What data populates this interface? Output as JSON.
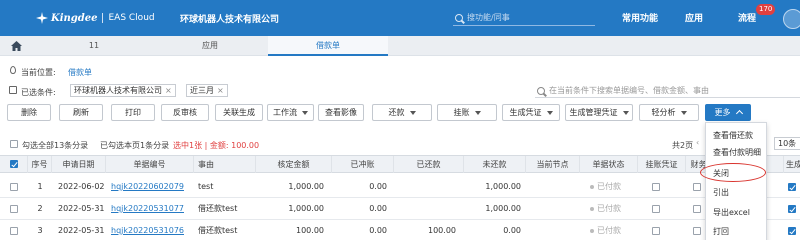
{
  "header": {
    "brand": "Kingdee",
    "product": "EAS Cloud",
    "company": "环球机器人技术有限公司",
    "search_placeholder": "搜功能/同事",
    "nav": [
      "常用功能",
      "应用",
      "流程"
    ],
    "badge": "170"
  },
  "tabs": {
    "items": [
      "11",
      "应用",
      "借款单"
    ],
    "active": "借款单"
  },
  "location": {
    "label": "当前位置:",
    "value": "借款单"
  },
  "filters": {
    "label": "已选条件:",
    "chips": [
      "环球机器人技术有限公司",
      "近三月"
    ],
    "search_placeholder": "在当前条件下搜索单据编号、借款金额、事由"
  },
  "toolbar": {
    "buttons": [
      "删除",
      "刷新",
      "打印",
      "反审核",
      "关联生成",
      "工作流",
      "查看影像",
      "还款",
      "挂账",
      "生成凭证",
      "生成管理凭证",
      "轻分析",
      "更多"
    ]
  },
  "info": {
    "select_all": "勾选全部13条分录",
    "select_page": "已勾选本页1条分录",
    "selected_summary": "选中1张 | 金额: 100.00",
    "total": "共2页",
    "page_current": "1",
    "page_total": "/2",
    "page_size": "10条"
  },
  "table": {
    "columns": [
      "序号",
      "申请日期",
      "单据编号",
      "事由",
      "核定金额",
      "已冲账",
      "已还款",
      "未还款",
      "当前节点",
      "单据状态",
      "挂账凭证",
      "财务",
      "",
      "生成"
    ],
    "rows": [
      {
        "seq": "1",
        "date": "2022-06-02",
        "number": "hqjk20220602079",
        "reason": "test",
        "approved": "1,000.00",
        "offset": "0.00",
        "repaid": "",
        "unpaid": "1,000.00",
        "node": "",
        "status": "已付款",
        "checked": false,
        "gen_checked": true
      },
      {
        "seq": "2",
        "date": "2022-05-31",
        "number": "hqjk20220531077",
        "reason": "借还款test",
        "approved": "1,000.00",
        "offset": "0.00",
        "repaid": "",
        "unpaid": "1,000.00",
        "node": "",
        "status": "已付款",
        "checked": false,
        "gen_checked": true
      },
      {
        "seq": "3",
        "date": "2022-05-31",
        "number": "hqjk20220531076",
        "reason": "借还款test",
        "approved": "100.00",
        "offset": "0.00",
        "repaid": "100.00",
        "unpaid": "0.00",
        "node": "",
        "status": "已付款",
        "checked": false,
        "gen_checked": true
      }
    ]
  },
  "more_menu": {
    "items": [
      "查看借还款",
      "查看付款明细",
      "关闭",
      "引出",
      "导出excel",
      "打回"
    ],
    "highlighted": "关闭"
  },
  "colors": {
    "brand": "#2479c4",
    "accent_red": "#e04040"
  }
}
